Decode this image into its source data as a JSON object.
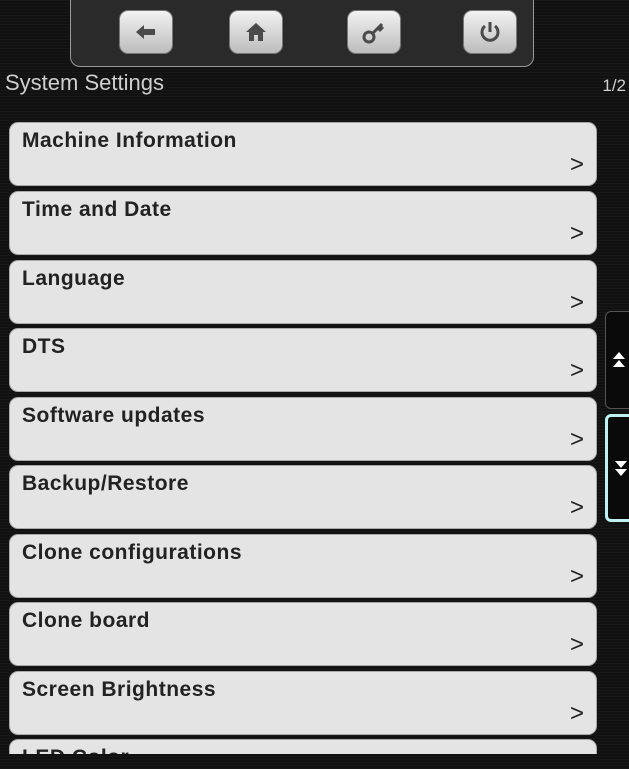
{
  "header": {
    "title": "System Settings",
    "page_indicator": "1/2"
  },
  "toolbar": {
    "buttons": [
      {
        "icon": "back-arrow-icon"
      },
      {
        "icon": "home-icon"
      },
      {
        "icon": "key-icon"
      },
      {
        "icon": "power-icon"
      }
    ]
  },
  "menu": {
    "arrow": ">",
    "items": [
      {
        "label": "Machine Information"
      },
      {
        "label": "Time and Date"
      },
      {
        "label": "Language"
      },
      {
        "label": "DTS"
      },
      {
        "label": "Software updates"
      },
      {
        "label": "Backup/Restore"
      },
      {
        "label": "Clone configurations"
      },
      {
        "label": "Clone board"
      },
      {
        "label": "Screen Brightness"
      },
      {
        "label": "LED Color"
      }
    ]
  },
  "colors": {
    "background": "#111111",
    "item_bg": "#e4e4e4",
    "selected_outline": "#bff0f2"
  }
}
